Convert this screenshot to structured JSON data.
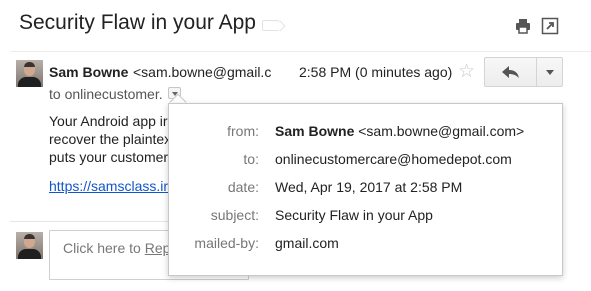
{
  "thread": {
    "subject": "Security Flaw in your App"
  },
  "icons": {
    "print": "print-icon",
    "popout": "new-window-icon",
    "star": "star-icon",
    "reply": "reply-arrow-icon",
    "more": "dropdown-arrow-icon",
    "details": "show-details-icon"
  },
  "message": {
    "sender_name": "Sam Bowne",
    "sender_email": "<sam.bowne@gmail.c",
    "time": "2:58 PM (0 minutes ago)",
    "to_line": "to onlinecustomer.",
    "body_lines": [
      "Your Android app ir",
      "recover the plaintex",
      "puts your customer"
    ],
    "link_text": "https://samsclass.ir"
  },
  "reply": {
    "placeholder_prefix": "Click here to ",
    "placeholder_link": "Rep"
  },
  "details": {
    "from_label": "from:",
    "from_name": "Sam Bowne",
    "from_email": "<sam.bowne@gmail.com>",
    "to_label": "to:",
    "to_value": "onlinecustomercare@homedepot.com",
    "date_label": "date:",
    "date_value": "Wed, Apr 19, 2017 at 2:58 PM",
    "subject_label": "subject:",
    "subject_value": "Security Flaw in your App",
    "mailedby_label": "mailed-by:",
    "mailedby_value": "gmail.com"
  },
  "colors": {
    "link": "#1155cc",
    "label_gray": "#777777",
    "star": "#c8c8c8"
  }
}
